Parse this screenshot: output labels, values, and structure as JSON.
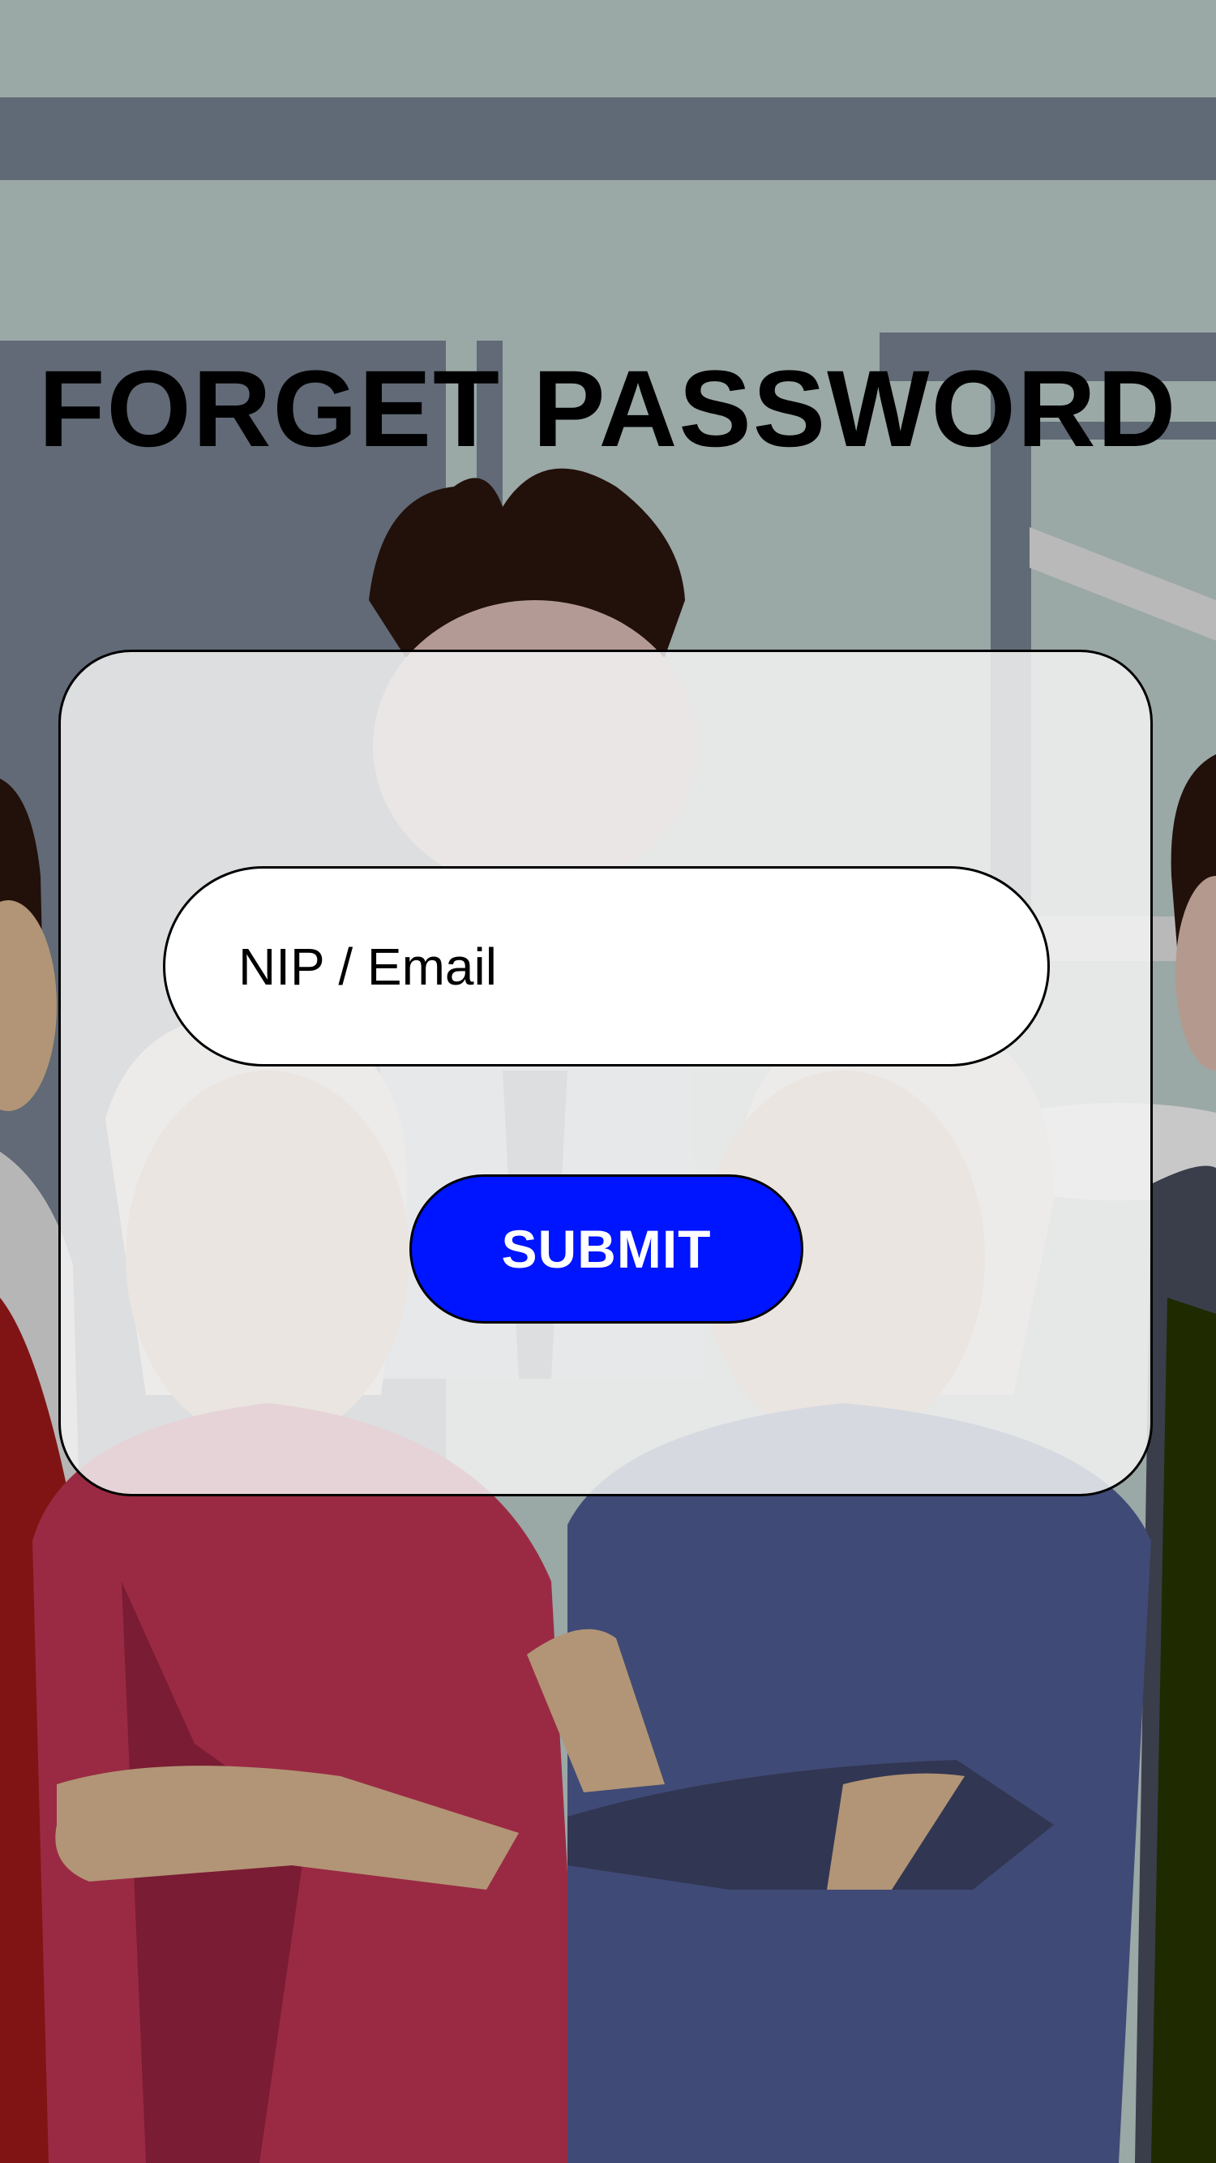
{
  "page": {
    "title": "FORGET PASSWORD"
  },
  "form": {
    "identifier_placeholder": "NIP / Email",
    "identifier_value": "",
    "submit_label": "SUBMIT"
  },
  "colors": {
    "submit_button": "#0015ff",
    "card_background": "#f4f4f4",
    "title_text": "#000000"
  },
  "background": {
    "illustration": "team-people-illustration"
  }
}
